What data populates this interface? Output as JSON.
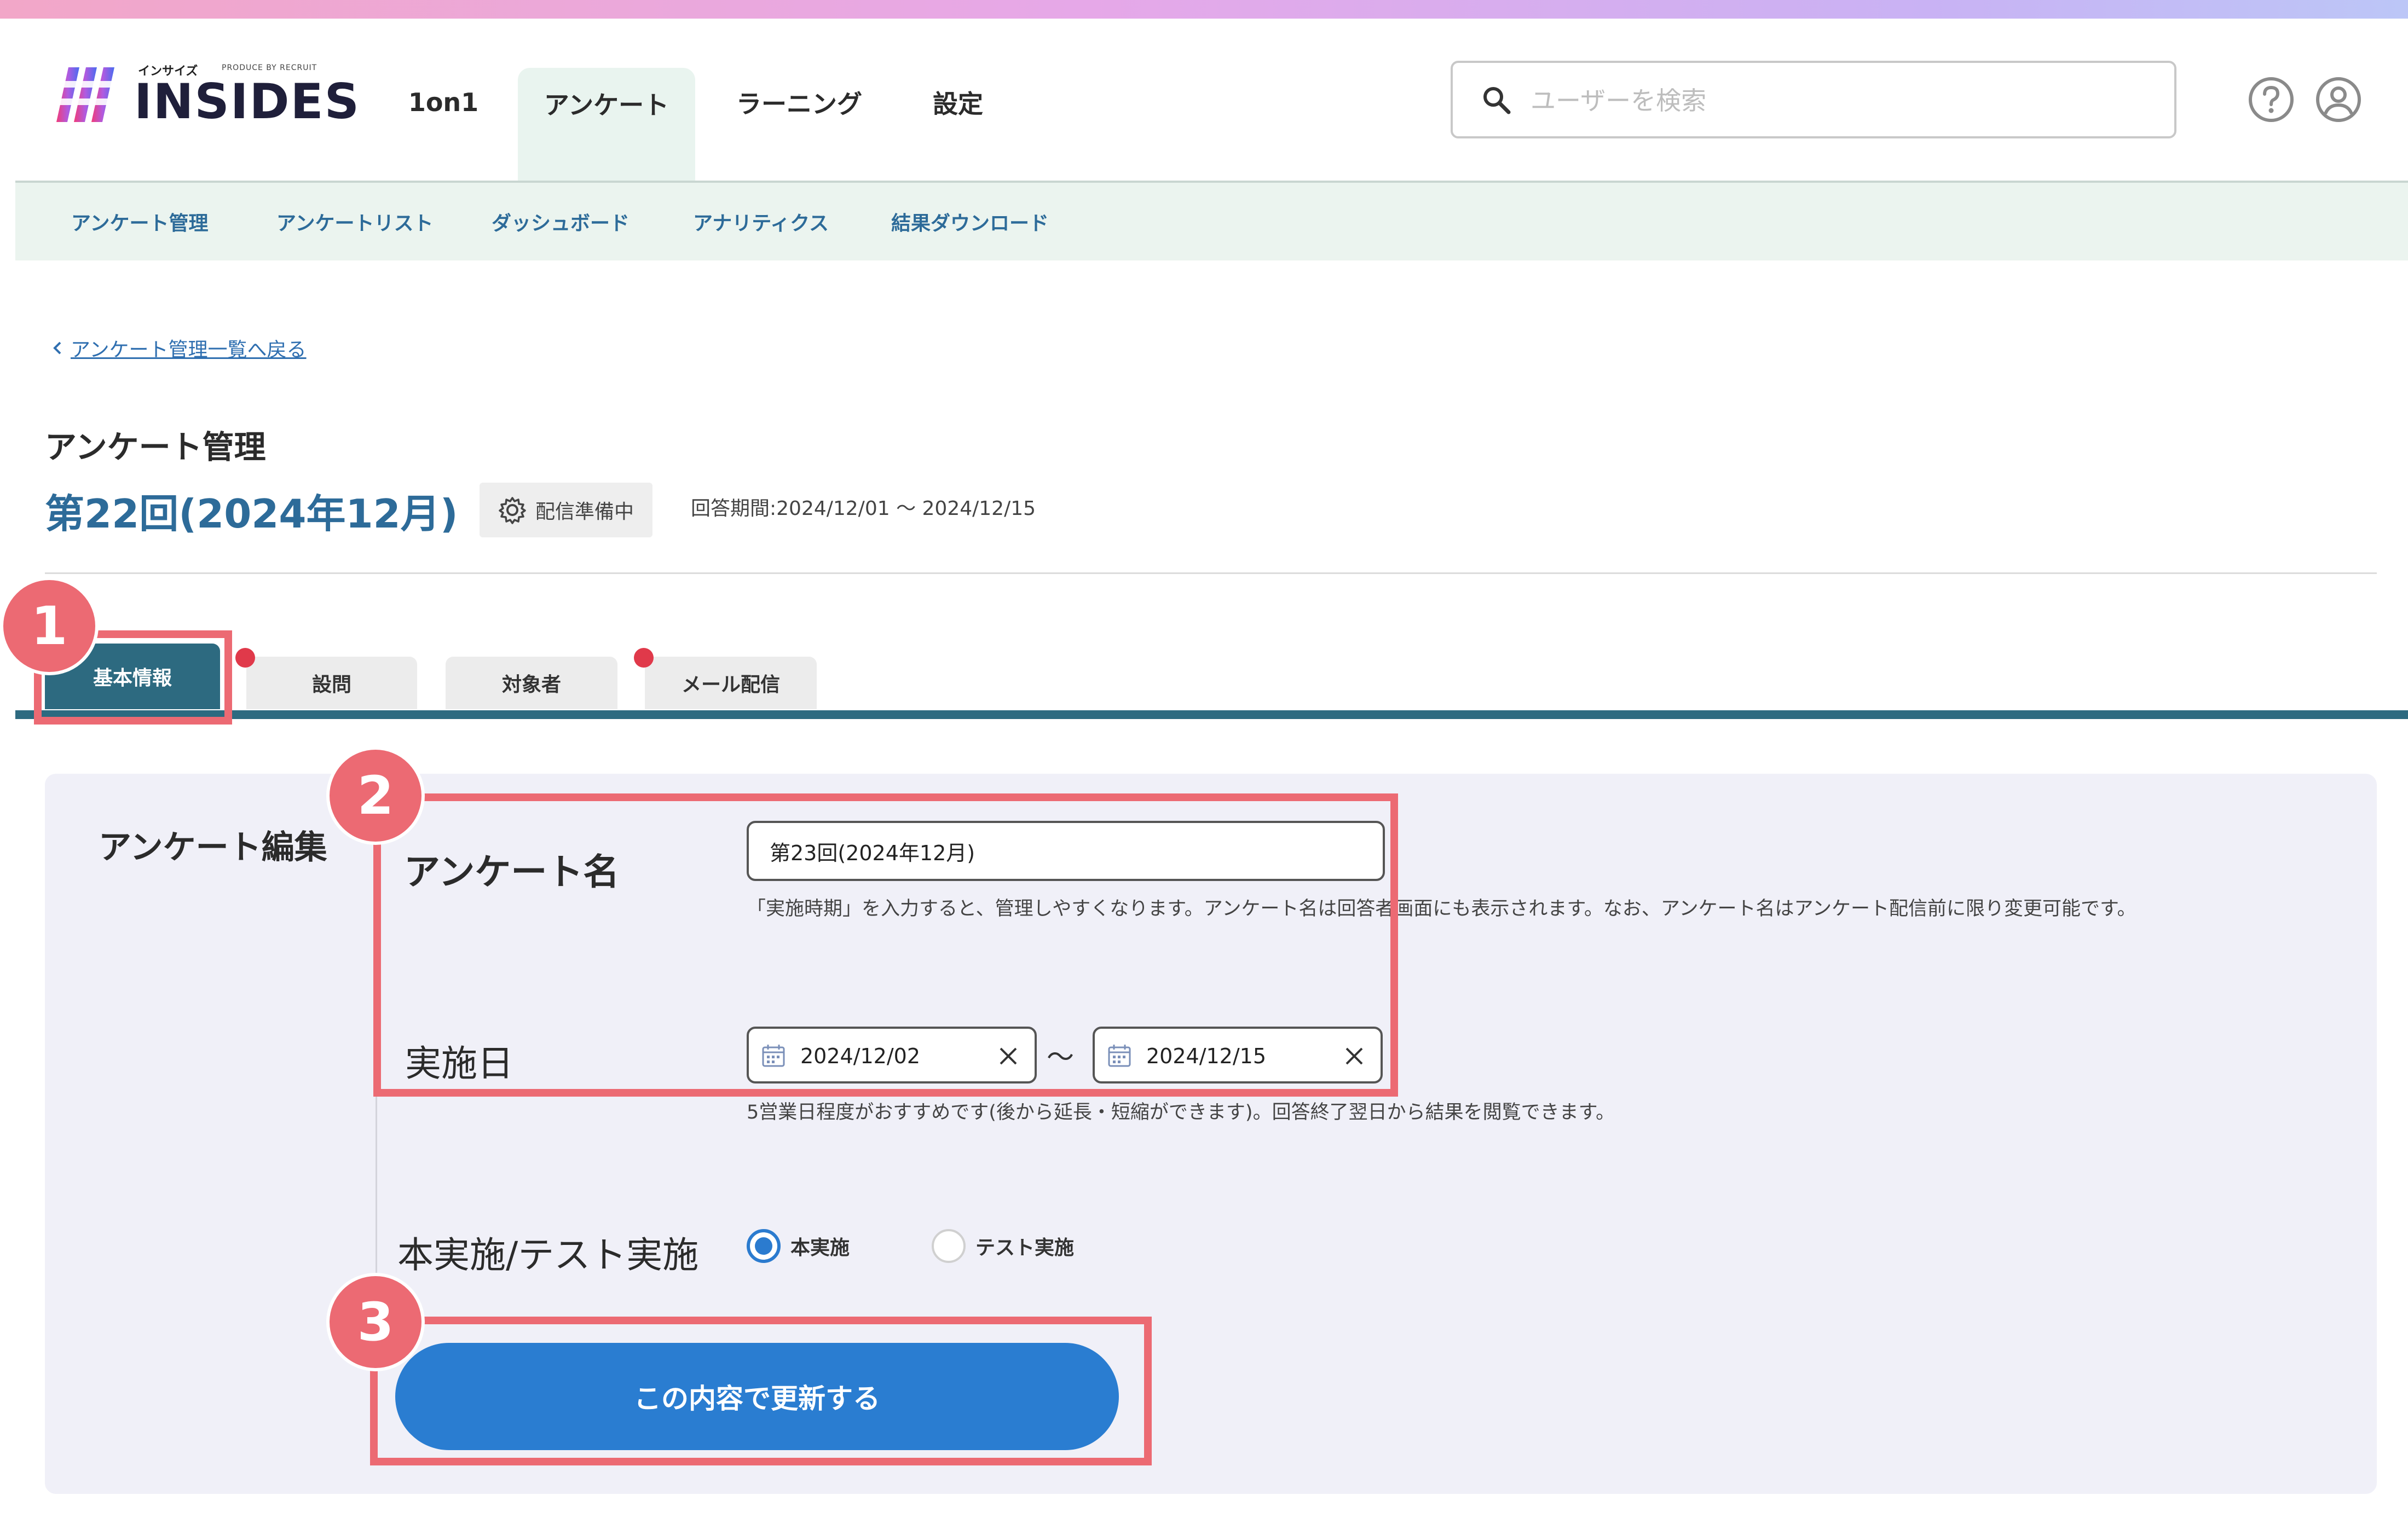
{
  "header": {
    "logo_small": "インサイズ",
    "logo_produce": "PRODUCE BY RECRUIT",
    "logo_word": "INSIDES",
    "nav": [
      "1on1",
      "アンケート",
      "ラーニング",
      "設定"
    ],
    "search_placeholder": "ユーザーを検索"
  },
  "subnav": [
    "アンケート管理",
    "アンケートリスト",
    "ダッシュボード",
    "アナリティクス",
    "結果ダウンロード"
  ],
  "back_link": "アンケート管理一覧へ戻る",
  "page": {
    "heading": "アンケート管理",
    "survey_title": "第22回(2024年12月)",
    "status": "配信準備中",
    "answer_period": "回答期間:2024/12/01 〜 2024/12/15"
  },
  "tabs": [
    "基本情報",
    "設問",
    "対象者",
    "メール配信"
  ],
  "form": {
    "heading": "アンケート編集",
    "name_label": "アンケート名",
    "name_value": "第23回(2024年12月)",
    "name_hint": "「実施時期」を入力すると、管理しやすくなります。アンケート名は回答者画面にも表示されます。なお、アンケート名はアンケート配信前に限り変更可能です。",
    "date_label": "実施日",
    "date_start": "2024/12/02",
    "date_sep": "〜",
    "date_end": "2024/12/15",
    "date_hint": "5営業日程度がおすすめです(後から延長・短縮ができます)。回答終了翌日から結果を閲覧できます。",
    "mode_label": "本実施/テスト実施",
    "mode_options": [
      "本実施",
      "テスト実施"
    ],
    "mode_selected": "本実施",
    "submit_label": "この内容で更新する"
  },
  "callouts": [
    "1",
    "2",
    "3"
  ],
  "colors": {
    "brand_teal": "#2d6a80",
    "link_blue": "#2d6b99",
    "button_blue": "#2a7dd1",
    "callout_red": "#ec6a73",
    "alert_dot": "#e0394a"
  }
}
